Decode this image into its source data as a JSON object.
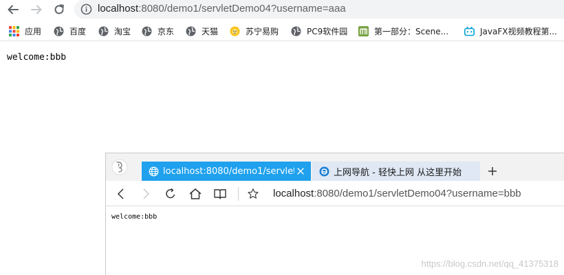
{
  "chrome": {
    "address": {
      "host": "localhost",
      "path": ":8080/demo1/servletDemo04?username=aaa"
    },
    "bookmarks": [
      {
        "label": "应用",
        "icon": "apps-grid-icon"
      },
      {
        "label": "百度",
        "icon": "globe-icon"
      },
      {
        "label": "淘宝",
        "icon": "globe-icon"
      },
      {
        "label": "京东",
        "icon": "globe-icon"
      },
      {
        "label": "天猫",
        "icon": "globe-icon"
      },
      {
        "label": "苏宁易购",
        "icon": "suning-lion-icon"
      },
      {
        "label": "PC9软件园",
        "icon": "globe-icon"
      },
      {
        "label": "第一部分：Scene...",
        "icon": "m-letter-icon"
      },
      {
        "label": "JavaFX视频教程第...",
        "icon": "bilibili-tv-icon"
      }
    ],
    "page_text": "welcome:bbb"
  },
  "edge": {
    "tabs": [
      {
        "title": "localhost:8080/demo1/servletDem",
        "icon": "globe-icon",
        "active": true
      },
      {
        "title": "上网导航 - 轻快上网 从这里开始",
        "icon": "ie-e-icon",
        "active": false
      }
    ],
    "address": {
      "host": "localhost",
      "path": ":8080/demo1/servletDemo04?username=bbb"
    },
    "page_text": "welcome:bbb"
  },
  "watermark": "https://blog.csdn.net/qq_41375318",
  "colors": {
    "edge_active_tab": "#1fa1ee",
    "edge_inactive_tab": "#dfe8f4",
    "chrome_omnibox": "#f1f3f4",
    "bookmark_green_m": "#7aa344",
    "bilibili_blue": "#00a1d6",
    "suning_yellow": "#f7c21b"
  }
}
